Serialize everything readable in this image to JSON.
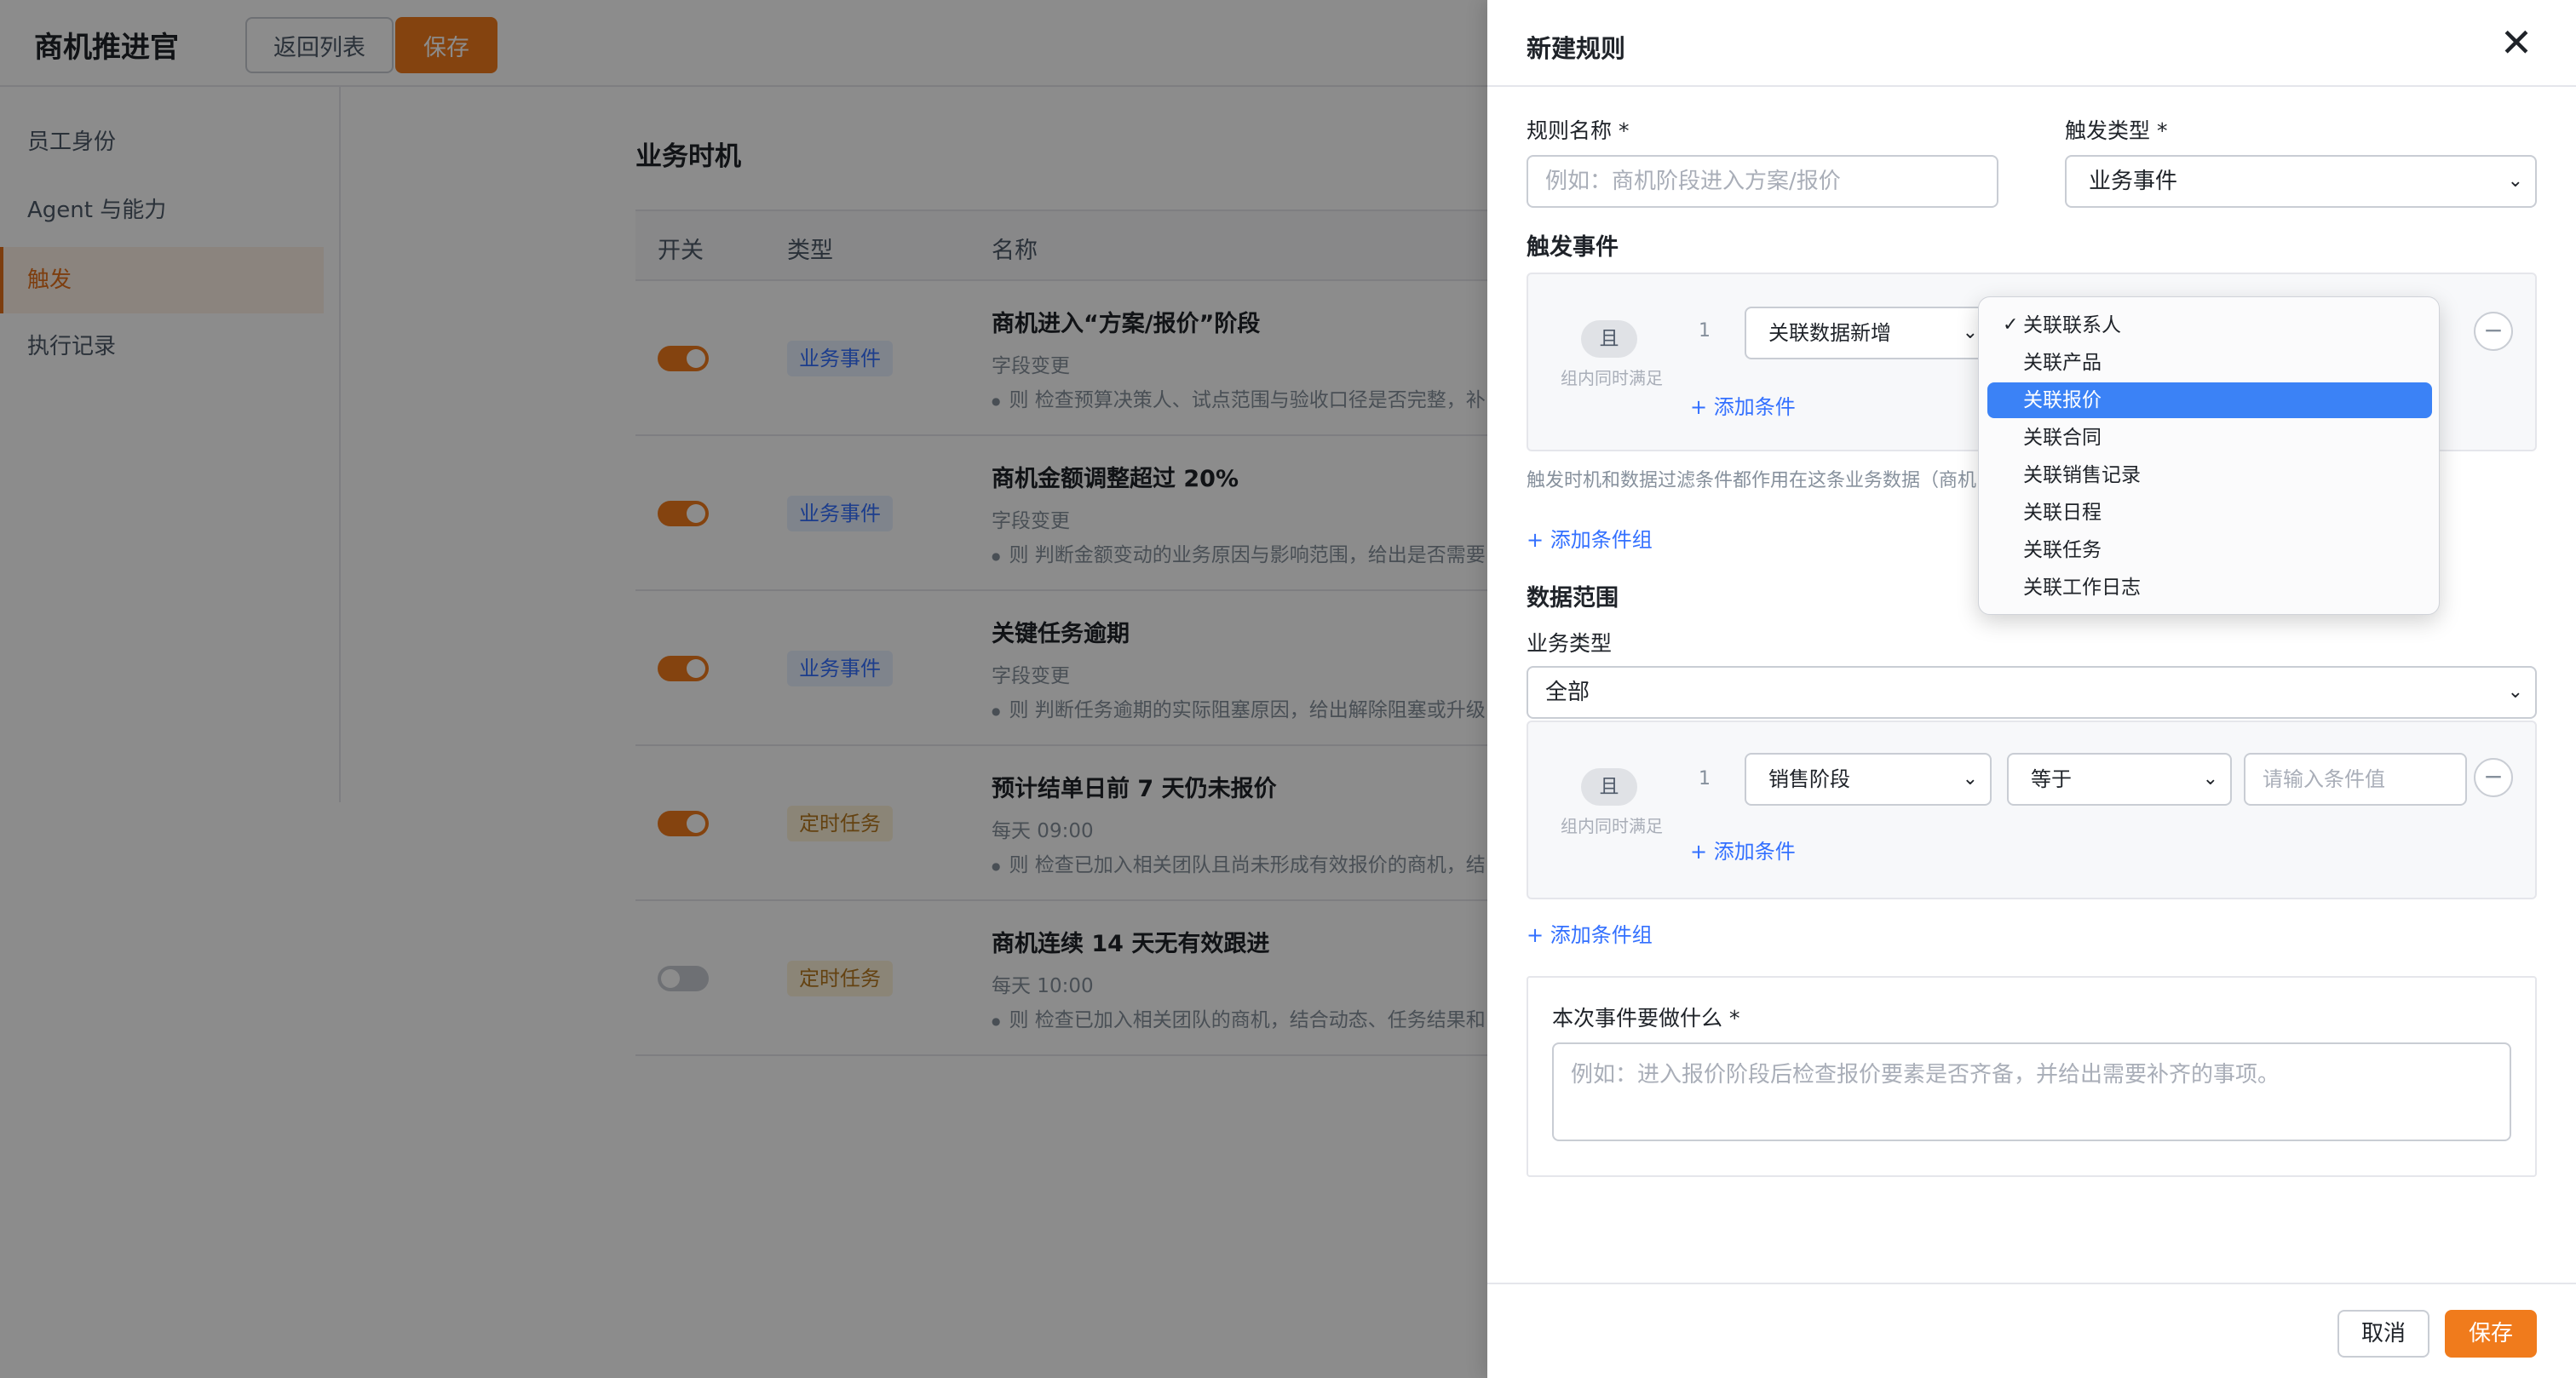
{
  "app": {
    "title": "商机推进官",
    "back_label": "返回列表",
    "save_label": "保存"
  },
  "sidebar": {
    "items": [
      {
        "label": "员工身份"
      },
      {
        "label": "Agent 与能力"
      },
      {
        "label": "触发"
      },
      {
        "label": "执行记录"
      }
    ]
  },
  "main": {
    "section_title": "业务时机",
    "columns": [
      "开关",
      "类型",
      "名称"
    ],
    "rows": [
      {
        "enabled": true,
        "type": "业务事件",
        "name": "商机进入“方案/报价”阶段",
        "sub": "字段变更",
        "desc": "则 检查预算决策人、试点范围与验收口径是否完整，补"
      },
      {
        "enabled": true,
        "type": "业务事件",
        "name": "商机金额调整超过 20%",
        "sub": "字段变更",
        "desc": "则 判断金额变动的业务原因与影响范围，给出是否需要"
      },
      {
        "enabled": true,
        "type": "业务事件",
        "name": "关键任务逾期",
        "sub": "字段变更",
        "desc": "则 判断任务逾期的实际阻塞原因，给出解除阻塞或升级"
      },
      {
        "enabled": true,
        "type": "定时任务",
        "name": "预计结单日前 7 天仍未报价",
        "sub": "每天 09:00",
        "desc": "则 检查已加入相关团队且尚未形成有效报价的商机，结"
      },
      {
        "enabled": false,
        "type": "定时任务",
        "name": "商机连续 14 天无有效跟进",
        "sub": "每天 10:00",
        "desc": "则 检查已加入相关团队的商机，结合动态、任务结果和"
      }
    ]
  },
  "drawer": {
    "title": "新建规则",
    "rule_name_label": "规则名称 *",
    "rule_name_placeholder": "例如：商机阶段进入方案/报价",
    "trigger_type_label": "触发类型 *",
    "trigger_type_value": "业务事件",
    "trigger_event_label": "触发事件",
    "and_badge": "且",
    "group_hint": "组内同时满足",
    "cond1": {
      "index": "1",
      "field": "关联数据新增"
    },
    "add_condition": "+ 添加条件",
    "trigger_note": "触发时机和数据过滤条件都作用在这条业务数据（商机",
    "add_condition_group": "+ 添加条件组",
    "data_scope_label": "数据范围",
    "biz_type_label": "业务类型",
    "biz_type_value": "全部",
    "cond2": {
      "index": "1",
      "field": "销售阶段",
      "operator": "等于",
      "value_placeholder": "请输入条件值"
    },
    "task_label": "本次事件要做什么 *",
    "task_placeholder": "例如：进入报价阶段后检查报价要素是否齐备，并给出需要补齐的事项。",
    "cancel_label": "取消",
    "save_label": "保存"
  },
  "dropdown": {
    "options": [
      {
        "label": "关联联系人",
        "checked": true,
        "highlight": false
      },
      {
        "label": "关联产品",
        "checked": false,
        "highlight": false
      },
      {
        "label": "关联报价",
        "checked": false,
        "highlight": true
      },
      {
        "label": "关联合同",
        "checked": false,
        "highlight": false
      },
      {
        "label": "关联销售记录",
        "checked": false,
        "highlight": false
      },
      {
        "label": "关联日程",
        "checked": false,
        "highlight": false
      },
      {
        "label": "关联任务",
        "checked": false,
        "highlight": false
      },
      {
        "label": "关联工作日志",
        "checked": false,
        "highlight": false
      }
    ]
  },
  "colors": {
    "accent": "#f07b1c",
    "link": "#3370ff",
    "highlight": "#3b82f6"
  }
}
